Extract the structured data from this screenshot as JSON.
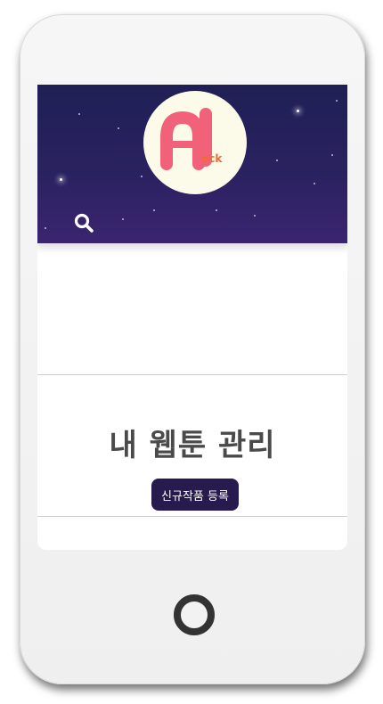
{
  "app": {
    "logo": {
      "letters_main": "AI",
      "letters_sub": "ock",
      "colors": {
        "main": "#f2617a",
        "sub": "#f06a33",
        "circle": "#fcfbea"
      }
    }
  },
  "header": {
    "background_colors": [
      "#1f1f55",
      "#3b2470"
    ],
    "search_icon": "search-icon"
  },
  "main": {
    "title": "내 웹툰 관리",
    "register_button_label": "신규작품 등록"
  },
  "colors": {
    "button_bg": "#271a4f",
    "title_text": "#4a4a4a",
    "phone_frame": "#f2f2f2"
  }
}
